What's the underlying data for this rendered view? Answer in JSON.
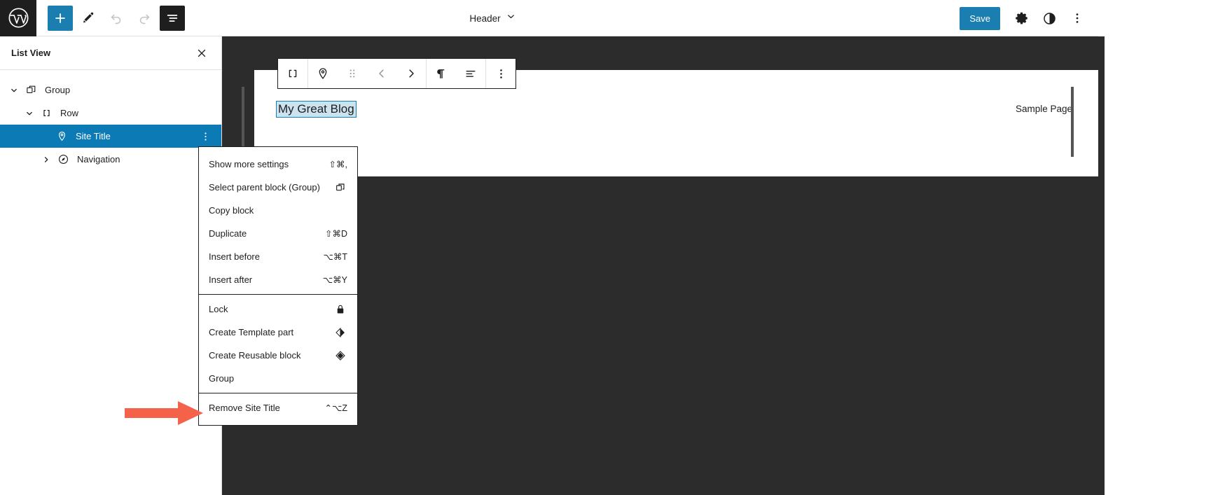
{
  "topbar": {
    "logo_icon": "wordpress-logo-icon",
    "tools": [
      {
        "name": "add-block-button",
        "icon": "plus-icon",
        "label": "Add block",
        "style": "primary"
      },
      {
        "name": "edit-mode-button",
        "icon": "pencil-icon",
        "label": "Edit",
        "style": "plain"
      },
      {
        "name": "undo-button",
        "icon": "undo-icon",
        "label": "Undo",
        "style": "disabled"
      },
      {
        "name": "redo-button",
        "icon": "redo-icon",
        "label": "Redo",
        "style": "disabled"
      },
      {
        "name": "list-view-button",
        "icon": "list-view-icon",
        "label": "List View",
        "style": "dark"
      }
    ],
    "document_title": "Header",
    "document_title_chevron": "chevron-down-icon",
    "save_label": "Save",
    "right_tools": [
      {
        "name": "settings-button",
        "icon": "gear-icon",
        "label": "Settings"
      },
      {
        "name": "styles-button",
        "icon": "contrast-icon",
        "label": "Styles"
      },
      {
        "name": "options-button",
        "icon": "ellipsis-vertical-icon",
        "label": "Options"
      }
    ]
  },
  "sidebar": {
    "title": "List View",
    "close_icon": "close-icon",
    "tree": [
      {
        "label": "Group",
        "icon": "group-icon",
        "chevron": "chevron-down-icon",
        "depth": 0,
        "selected": false,
        "has_more": false
      },
      {
        "label": "Row",
        "icon": "row-icon",
        "chevron": "chevron-down-icon",
        "depth": 1,
        "selected": false,
        "has_more": false
      },
      {
        "label": "Site Title",
        "icon": "site-title-pin-icon",
        "chevron": "",
        "depth": 2,
        "selected": true,
        "has_more": true
      },
      {
        "label": "Navigation",
        "icon": "navigation-icon",
        "chevron": "chevron-right-icon",
        "depth": 1,
        "selected": false,
        "has_more": false
      }
    ],
    "row_more_icon": "ellipsis-vertical-icon"
  },
  "block_toolbar": {
    "buttons": [
      {
        "name": "parent-row-block-button",
        "icon": "row-icon",
        "muted": false,
        "group": 0
      },
      {
        "name": "block-type-button",
        "icon": "site-title-pin-icon",
        "muted": false,
        "group": 1
      },
      {
        "name": "drag-handle-button",
        "icon": "drag-dots-icon",
        "muted": true,
        "group": 1
      },
      {
        "name": "move-left-button",
        "icon": "chevron-left-icon",
        "muted": true,
        "group": 1
      },
      {
        "name": "move-right-button",
        "icon": "chevron-right-icon",
        "muted": false,
        "group": 1
      },
      {
        "name": "change-heading-level-button",
        "icon": "pilcrow-icon",
        "muted": false,
        "group": 2
      },
      {
        "name": "align-text-button",
        "icon": "align-left-icon",
        "muted": false,
        "group": 2
      },
      {
        "name": "block-options-button",
        "icon": "ellipsis-vertical-icon",
        "muted": false,
        "group": 3
      }
    ]
  },
  "canvas": {
    "site_title": "My Great Blog",
    "nav_item": "Sample Page"
  },
  "dropdown": {
    "sections": [
      {
        "items": [
          {
            "label": "Show more settings",
            "shortcut": "⇧⌘,",
            "icon": "",
            "name": "menu-show-more-settings"
          },
          {
            "label": "Select parent block (Group)",
            "shortcut": "",
            "icon": "group-icon",
            "name": "menu-select-parent-block"
          },
          {
            "label": "Copy block",
            "shortcut": "",
            "icon": "",
            "name": "menu-copy-block"
          },
          {
            "label": "Duplicate",
            "shortcut": "⇧⌘D",
            "icon": "",
            "name": "menu-duplicate"
          },
          {
            "label": "Insert before",
            "shortcut": "⌥⌘T",
            "icon": "",
            "name": "menu-insert-before"
          },
          {
            "label": "Insert after",
            "shortcut": "⌥⌘Y",
            "icon": "",
            "name": "menu-insert-after"
          }
        ]
      },
      {
        "items": [
          {
            "label": "Lock",
            "shortcut": "",
            "icon": "lock-icon",
            "name": "menu-lock"
          },
          {
            "label": "Create Template part",
            "shortcut": "",
            "icon": "template-part-icon",
            "name": "menu-create-template-part"
          },
          {
            "label": "Create Reusable block",
            "shortcut": "",
            "icon": "reusable-block-icon",
            "name": "menu-create-reusable-block"
          },
          {
            "label": "Group",
            "shortcut": "",
            "icon": "",
            "name": "menu-group"
          }
        ]
      },
      {
        "items": [
          {
            "label": "Remove Site Title",
            "shortcut": "⌃⌥Z",
            "icon": "",
            "name": "menu-remove-site-title"
          }
        ]
      }
    ]
  },
  "annotation": {
    "arrow_color": "#f4624a",
    "arrow_points_to": "Remove Site Title"
  },
  "colors": {
    "accent_blue": "#1a7eb0",
    "selected_row": "#0c7ab5",
    "canvas_bg": "#2c2c2c",
    "border": "#1e1e1e"
  }
}
